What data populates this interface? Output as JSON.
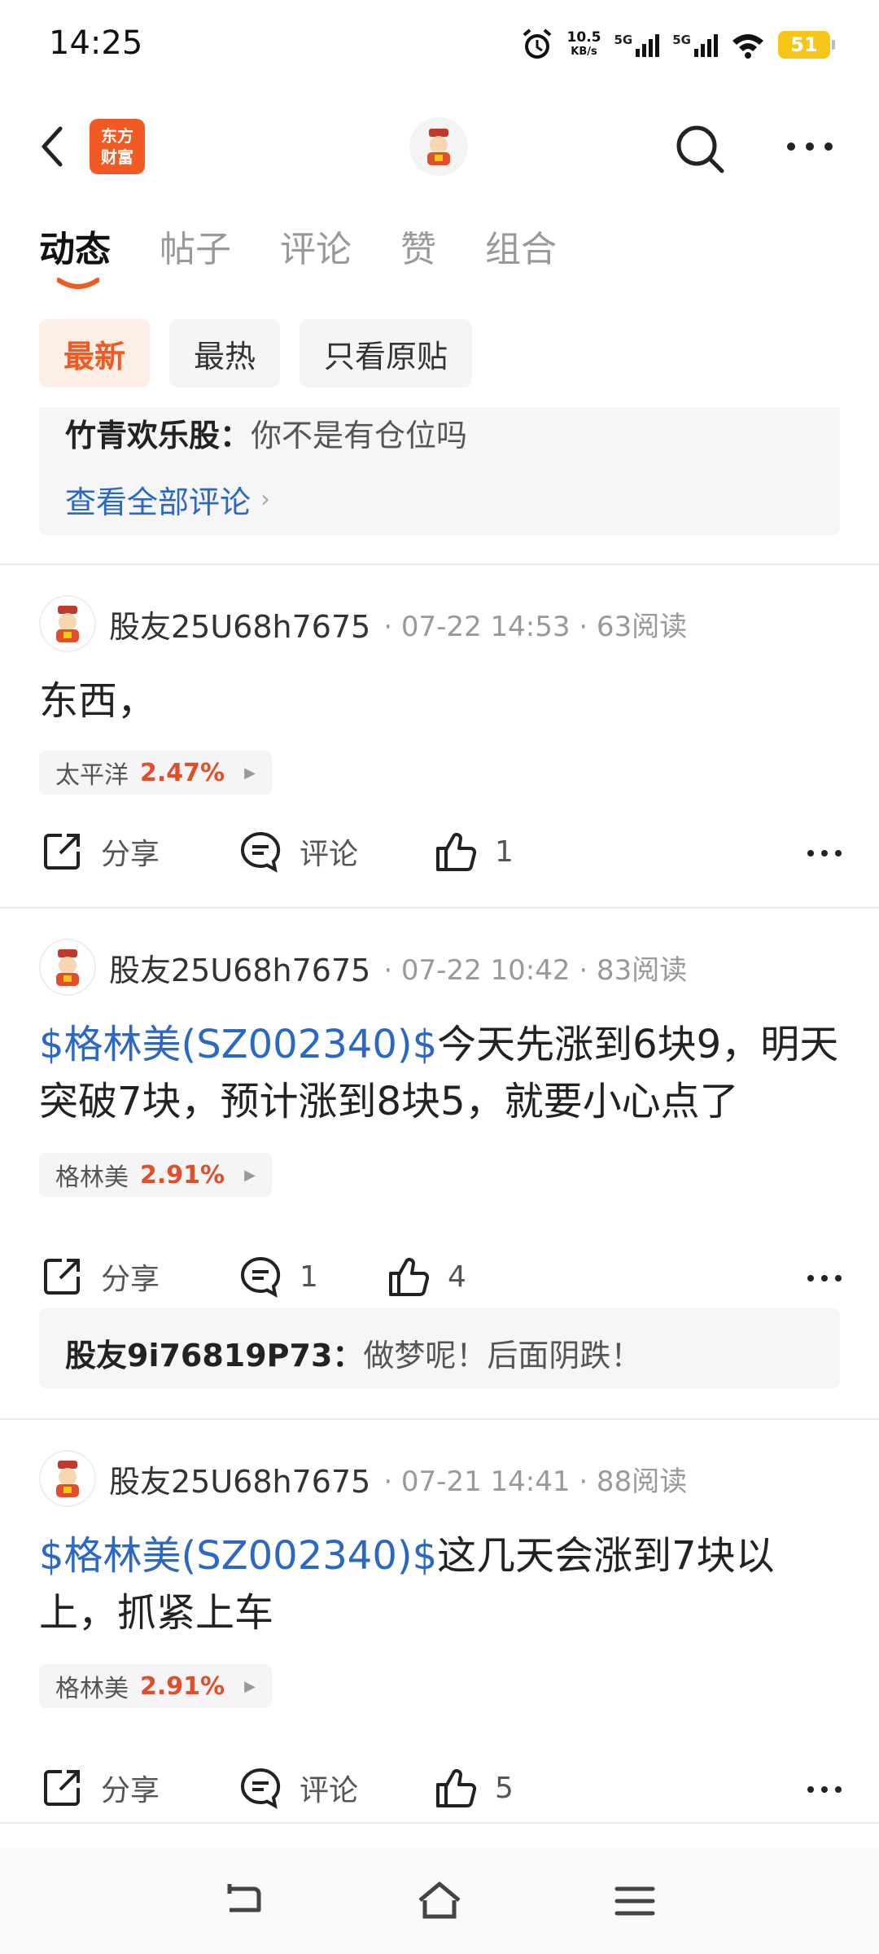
{
  "status": {
    "time": "14:25",
    "net_speed_value": "10.5",
    "net_speed_unit": "KB/s",
    "sig1": "5G",
    "sig2": "5G",
    "battery": "51"
  },
  "header": {
    "brand_line1": "东方",
    "brand_line2": "财富"
  },
  "tabs": [
    {
      "label": "动态"
    },
    {
      "label": "帖子"
    },
    {
      "label": "评论"
    },
    {
      "label": "赞"
    },
    {
      "label": "组合"
    }
  ],
  "filters": [
    {
      "label": "最新"
    },
    {
      "label": "最热"
    },
    {
      "label": "只看原贴"
    }
  ],
  "top_comment": {
    "user": "竹青欢乐股",
    "sep": "：",
    "text": "你不是有仓位吗",
    "view_all": "查看全部评论",
    "chevron": "›"
  },
  "posts": [
    {
      "user": "股友25U68h7675",
      "meta": "· 07-22 14:53 · 63阅读",
      "stock_link": "",
      "text": "东西，",
      "tag": {
        "name": "太平洋",
        "pct": "2.47%"
      },
      "share": "分享",
      "comment": "评论",
      "likes": "1"
    },
    {
      "user": "股友25U68h7675",
      "meta": "· 07-22 10:42 · 83阅读",
      "stock_link": "$格林美(SZ002340)$",
      "text": "今天先涨到6块9，明天突破7块，预计涨到8块5，就要小心点了",
      "tag": {
        "name": "格林美",
        "pct": "2.91%"
      },
      "share": "分享",
      "comment": "1",
      "likes": "4",
      "reply": {
        "user": "股友9i76819P73",
        "sep": "：",
        "text": "做梦呢！后面阴跌！"
      }
    },
    {
      "user": "股友25U68h7675",
      "meta": "· 07-21 14:41 · 88阅读",
      "stock_link": "$格林美(SZ002340)$",
      "text": "这几天会涨到7块以上，抓紧上车",
      "tag": {
        "name": "格林美",
        "pct": "2.91%"
      },
      "share": "分享",
      "comment": "评论",
      "likes": "5"
    }
  ],
  "colors": {
    "brand": "#f15a22",
    "link": "#2b67c4",
    "up": "#e04e2a"
  }
}
